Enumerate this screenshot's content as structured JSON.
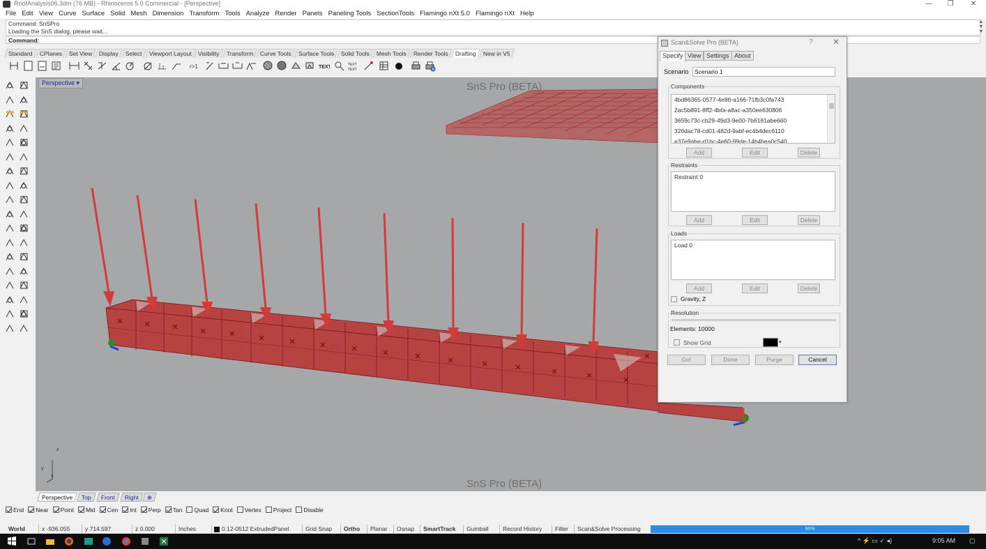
{
  "window": {
    "title": "RoofAnalysis06.3dm (76 MB) - Rhinoceros 5.0 Commercial - [Perspective]",
    "minimize": "—",
    "restore": "❐",
    "close": "✕"
  },
  "menu": [
    "File",
    "Edit",
    "View",
    "Curve",
    "Surface",
    "Solid",
    "Mesh",
    "Dimension",
    "Transform",
    "Tools",
    "Analyze",
    "Render",
    "Panels",
    "Paneling Tools",
    "SectionTools",
    "Flamingo nXt 5.0",
    "Flamingo nXt",
    "Help"
  ],
  "command": {
    "history_1": "Command: SnSPro",
    "history_2": "Loading the SnS dialog, please wait...",
    "prompt": "Command:"
  },
  "toolbar_tabs": [
    "Standard",
    "CPlanes",
    "Set View",
    "Display",
    "Select",
    "Viewport Layout",
    "Visibility",
    "Transform",
    "Curve Tools",
    "Surface Tools",
    "Solid Tools",
    "Mesh Tools",
    "Render Tools",
    "Drafting",
    "New in V5"
  ],
  "toolbar_tabs_active": 13,
  "viewport": {
    "label": "Perspective",
    "dropdown_icon": "▾",
    "watermark_top": "SnS Pro (BETA)",
    "watermark_bottom": "SnS Pro (BETA)",
    "axis_x": "x",
    "axis_y": "y",
    "axis_z": "z"
  },
  "viewport_tabs": [
    "Perspective",
    "Top",
    "Front",
    "Right"
  ],
  "viewport_tabs_add": "⊕",
  "osnap": [
    {
      "label": "End",
      "on": true
    },
    {
      "label": "Near",
      "on": true
    },
    {
      "label": "Point",
      "on": true
    },
    {
      "label": "Mid",
      "on": true
    },
    {
      "label": "Cen",
      "on": true
    },
    {
      "label": "Int",
      "on": true
    },
    {
      "label": "Perp",
      "on": true
    },
    {
      "label": "Tan",
      "on": true
    },
    {
      "label": "Quad",
      "on": false
    },
    {
      "label": "Knot",
      "on": true
    },
    {
      "label": "Vertex",
      "on": false
    },
    {
      "label": "Project",
      "on": false
    },
    {
      "label": "Disable",
      "on": false
    }
  ],
  "status": {
    "cplane": "World",
    "x": "x -936.055",
    "y": "y 714.597",
    "z": "z 0.000",
    "units": "Inches",
    "layer": "0.12-0512 ExtrudedPanel",
    "grid_snap": "Grid Snap",
    "ortho": "Ortho",
    "planar": "Planar",
    "osnap": "Osnap",
    "smarttrack": "SmartTrack",
    "gumball": "Gumball",
    "record_history": "Record History",
    "filter": "Filter",
    "task": "Scan&Solve Processing",
    "progress": "96%",
    "progress_value": 0.96
  },
  "taskbar": {
    "time": "9:05 AM"
  },
  "dialog": {
    "title": "Scan&Solve Pro (BETA)",
    "help": "?",
    "close": "✕",
    "tabs": [
      "Specify",
      "View",
      "Settings",
      "About"
    ],
    "tabs_active": 0,
    "scenario_label": "Scenario",
    "scenario_value": "Scenario 1",
    "components_label": "Components",
    "components": [
      "4bd86365-0577-4e86-a166-71fb3c0fa743",
      "2ac5b891-8ff2-4bfa-a8ac-a350ee630806",
      "3659c73c-cb29-49d3-9e00-7b6181abe660",
      "326dac78-cd01-482d-9abf-ec4b4dec6110",
      "e37e9abe-d1bc-4e60-99de-14b4bea0c540"
    ],
    "restraints_label": "Restraints",
    "restraints": [
      "Restraint 0"
    ],
    "loads_label": "Loads",
    "loads": [
      "Load 0"
    ],
    "btn_add": "Add",
    "btn_edit": "Edit",
    "btn_delete": "Delete",
    "gravity_label": "Gravity, Z",
    "resolution_label": "Resolution",
    "elements_label": "Elements: 10000",
    "show_grid_label": "Show Grid",
    "mesh_color": "#000000",
    "btn_go": "Go!",
    "btn_done": "Done",
    "btn_purge": "Purge",
    "btn_cancel": "Cancel"
  },
  "colors": {
    "viewport_bg": "#a5a7a9",
    "model_red": "#b8312f",
    "arrow_red": "#d43a3a",
    "progress_blue": "#2a8de0"
  }
}
